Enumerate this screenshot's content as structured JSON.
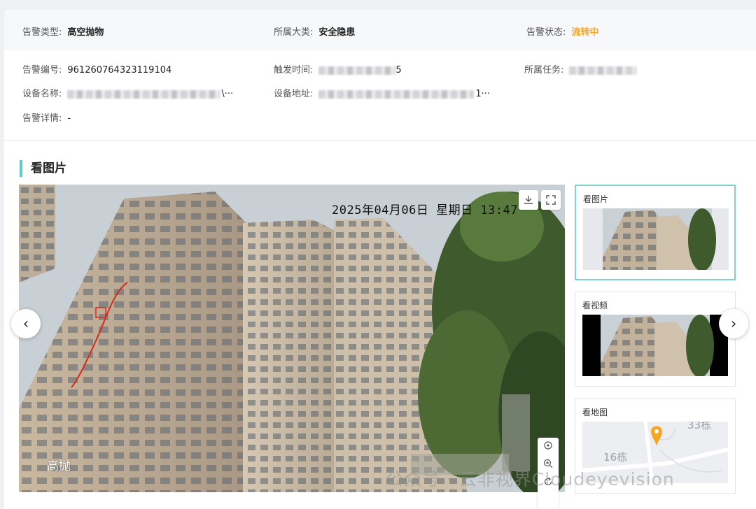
{
  "status_row": {
    "alarm_type_label": "告警类型:",
    "alarm_type_value": "高空抛物",
    "category_label": "所属大类:",
    "category_value": "安全隐患",
    "alarm_status_label": "告警状态:",
    "alarm_status_value": "流转中"
  },
  "details": {
    "alarm_no_label": "告警编号:",
    "alarm_no_value": "961260764323119104",
    "trigger_time_label": "触发时间:",
    "trigger_time_tail": "5",
    "task_label": "所属任务:",
    "device_name_label": "设备名称:",
    "device_name_tail": "\\···",
    "device_addr_label": "设备地址:",
    "device_addr_tail": "1···",
    "detail_label": "告警详情:",
    "detail_value": "-"
  },
  "section_title": "看图片",
  "viewer": {
    "osd_time": "2025年04月06日 星期日 13:47",
    "corner_label": "高抛",
    "prev_label": "‹",
    "next_label": "›"
  },
  "thumbnails": [
    {
      "label": "看图片"
    },
    {
      "label": "看视频"
    },
    {
      "label": "看地图"
    }
  ],
  "map": {
    "building_a": "16栋",
    "building_b": "33栋",
    "pin_color": "#f5a623"
  },
  "watermark": "公众号 · 云非视界Cloudeyevision",
  "colors": {
    "accent": "#5ccfc4",
    "status_orange": "#f5a623",
    "alarm_track": "#d62a1e"
  },
  "icons": {
    "download": "download-icon",
    "fullscreen": "fullscreen-icon",
    "locate": "locate-icon",
    "zoom_in": "zoom-in-icon",
    "rotate": "rotate-icon"
  }
}
